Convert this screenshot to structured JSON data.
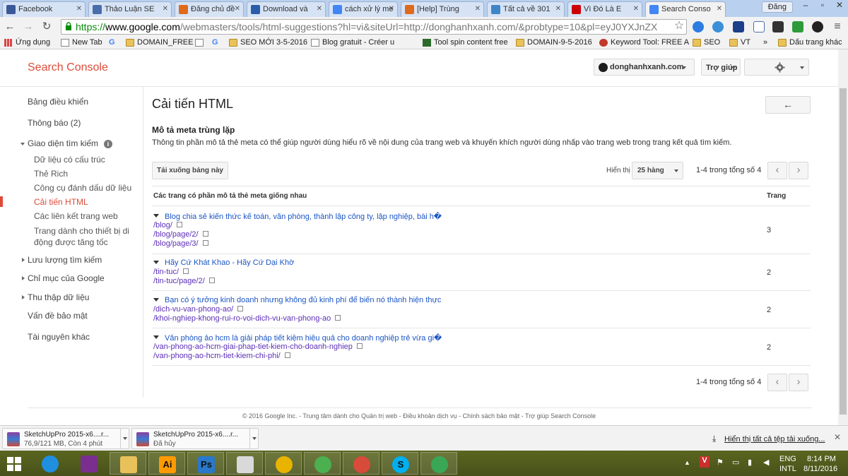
{
  "browser": {
    "tabs": [
      {
        "title": "Facebook",
        "color": "#3b5998"
      },
      {
        "title": "Thảo Luận SE",
        "color": "#4a6ea9"
      },
      {
        "title": "Đăng chủ đề",
        "color": "#e06a1b"
      },
      {
        "title": "Download và",
        "color": "#2a5caa"
      },
      {
        "title": "cách xử lý me",
        "color": "#4285f4"
      },
      {
        "title": "[Help] Trùng",
        "color": "#e06a1b"
      },
      {
        "title": "Tất cả về 301",
        "color": "#3d85c6"
      },
      {
        "title": "Vì Đó Là E",
        "color": "#cc0000"
      },
      {
        "title": "Search Conso",
        "color": "#4285f4"
      }
    ],
    "user_button": "Đăng",
    "address": {
      "scheme": "https://",
      "host": "www.google.com",
      "path": "/webmasters/tools/html-suggestions?hl=vi&siteUrl=http://donghanhxanh.com/&probtype=10&pl=eyJ0YXJnZX"
    },
    "bookmarks": [
      {
        "label": "Ứng dụng",
        "type": "apps"
      },
      {
        "label": "New Tab",
        "type": "page"
      },
      {
        "label": "",
        "type": "google"
      },
      {
        "label": "DOMAIN_FREE",
        "type": "folder"
      },
      {
        "label": "",
        "type": "page"
      },
      {
        "label": "",
        "type": "google"
      },
      {
        "label": "SEO MỚI 3-5-2016",
        "type": "folder"
      },
      {
        "label": "Blog gratuit - Créer u",
        "type": "page"
      },
      {
        "label": "Tool spin content free",
        "type": "page"
      },
      {
        "label": "DOMAIN-9-5-2016",
        "type": "folder"
      },
      {
        "label": "Keyword Tool: FREE A",
        "type": "page"
      },
      {
        "label": "SEO",
        "type": "folder"
      },
      {
        "label": "VT",
        "type": "folder"
      }
    ],
    "bookmarks_more": "»",
    "bookmarks_other": "Dấu trang khác"
  },
  "header": {
    "logo": "Search Console",
    "site": "donghanhxanh.com",
    "help": "Trợ giúp"
  },
  "sidebar": {
    "items": [
      {
        "label": "Bảng điều khiển",
        "level": 0
      },
      {
        "label": "Thông báo (2)",
        "level": 0
      },
      {
        "label": "Giao diện tìm kiếm",
        "level": 0,
        "expanded": true,
        "info": true
      },
      {
        "label": "Dữ liệu có cấu trúc",
        "level": 1
      },
      {
        "label": "Thẻ Rich",
        "level": 1
      },
      {
        "label": "Công cụ đánh dấu dữ liệu",
        "level": 1
      },
      {
        "label": "Cải tiến HTML",
        "level": 1,
        "active": true
      },
      {
        "label": "Các liên kết trang web",
        "level": 1
      },
      {
        "label": "Trang dành cho thiết bị di",
        "level": 1
      },
      {
        "label": "động được tăng tốc",
        "level": 1
      },
      {
        "label": "Lưu lượng tìm kiếm",
        "level": 0,
        "expanded": false
      },
      {
        "label": "Chỉ mục của Google",
        "level": 0,
        "expanded": false
      },
      {
        "label": "Thu thập dữ liệu",
        "level": 0,
        "expanded": false
      },
      {
        "label": "Vấn đề bảo mật",
        "level": 0
      },
      {
        "label": "Tài nguyên khác",
        "level": 0
      }
    ]
  },
  "main": {
    "title": "Cải tiến HTML",
    "back_icon": "←",
    "section_title": "Mô tả meta trùng lặp",
    "section_desc": "Thông tin phần mô tả thẻ meta có thể giúp người dùng hiểu rõ về nội dung của trang web và khuyến khích người dùng nhấp vào trang web trong trang kết quả tìm kiếm.",
    "download_label": "Tải xuống bảng này",
    "show_label": "Hiển thị",
    "rows_value": "25 hàng",
    "pager_text": "1-4 trong tổng số 4",
    "columns": [
      "Các trang có phần mô tả thẻ meta giống nhau",
      "Trang"
    ],
    "groups": [
      {
        "title": "Blog chia sẻ kiến thức kế toán, văn phòng, thành lập công ty, lập nghiệp, bài h�",
        "urls": [
          "/blog/",
          "/blog/page/2/",
          "/blog/page/3/"
        ],
        "count": "3"
      },
      {
        "title": "Hãy Cứ Khát Khao - Hãy Cứ Dại Khờ",
        "urls": [
          "/tin-tuc/",
          "/tin-tuc/page/2/"
        ],
        "count": "2"
      },
      {
        "title": "Bạn có ý tưởng kinh doanh nhưng không đủ kinh phí để biến nó thành hiện thực",
        "urls": [
          "/dich-vu-van-phong-ao/",
          "/khoi-nghiep-khong-rui-ro-voi-dich-vu-van-phong-ao"
        ],
        "count": "2"
      },
      {
        "title": "Văn phòng ảo hcm là giải pháp tiết kiệm hiệu quả cho doanh nghiệp trẻ vừa gi�",
        "urls": [
          "/van-phong-ao-hcm-giai-phap-tiet-kiem-cho-doanh-nghiep",
          "/van-phong-ao-hcm-tiet-kiem-chi-phi/"
        ],
        "count": "2"
      }
    ]
  },
  "footer": "© 2016 Google Inc. - Trung tâm dành cho Quản trị web - Điều khoản dịch vụ - Chính sách bảo mật - Trợ giúp Search Console",
  "downloads": {
    "items": [
      {
        "name": "SketchUpPro 2015-x6....r...",
        "status": "76,9/121 MB, Còn 4 phút"
      },
      {
        "name": "SketchUpPro 2015-x6....r...",
        "status": "Đã hủy"
      }
    ],
    "show_all": "Hiển thị tất cả tệp tải xuống..."
  },
  "taskbar": {
    "apps": [
      {
        "name": "internet-explorer",
        "color": "#1f8fe0"
      },
      {
        "name": "winrar",
        "color": "#7a2f8e"
      },
      {
        "name": "file-explorer",
        "color": "#e8c15a"
      },
      {
        "name": "illustrator",
        "color": "#ff9a00",
        "glyph": "Ai"
      },
      {
        "name": "photoshop",
        "color": "#2a78c9",
        "glyph": "Ps"
      },
      {
        "name": "fax-app",
        "color": "#d9d9d9"
      },
      {
        "name": "chrome",
        "color": "#e8b400"
      },
      {
        "name": "coccoc",
        "color": "#4caf50"
      },
      {
        "name": "chrome-user",
        "color": "#d84a3a"
      },
      {
        "name": "skype",
        "color": "#00aff0",
        "glyph": "S"
      },
      {
        "name": "chrome-h",
        "color": "#3aa757"
      }
    ],
    "lang": "ENG",
    "layout": "INTL",
    "time": "8:14 PM",
    "date": "8/11/2016"
  }
}
